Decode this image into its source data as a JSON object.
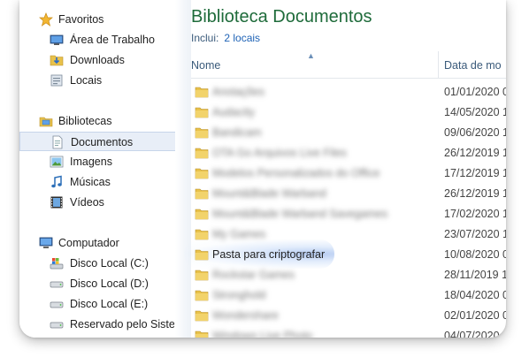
{
  "sidebar": {
    "favorites": {
      "label": "Favoritos",
      "items": [
        {
          "label": "Área de Trabalho",
          "icon": "desktop-icon"
        },
        {
          "label": "Downloads",
          "icon": "downloads-folder-icon"
        },
        {
          "label": "Locais",
          "icon": "recent-places-icon"
        }
      ]
    },
    "libraries": {
      "label": "Bibliotecas",
      "items": [
        {
          "label": "Documentos",
          "icon": "documents-icon",
          "selected": true
        },
        {
          "label": "Imagens",
          "icon": "pictures-icon"
        },
        {
          "label": "Músicas",
          "icon": "music-icon"
        },
        {
          "label": "Vídeos",
          "icon": "videos-icon"
        }
      ]
    },
    "computer": {
      "label": "Computador",
      "items": [
        {
          "label": "Disco Local (C:)",
          "icon": "system-drive-icon"
        },
        {
          "label": "Disco Local (D:)",
          "icon": "drive-icon"
        },
        {
          "label": "Disco Local (E:)",
          "icon": "drive-icon"
        },
        {
          "label": "Reservado pelo Sistema",
          "icon": "drive-icon"
        }
      ]
    }
  },
  "main": {
    "title": "Biblioteca Documentos",
    "includes_label": "Inclui:",
    "includes_link": "2 locais",
    "columns": {
      "name": "Nome",
      "date": "Data de mo"
    },
    "rows": [
      {
        "name": "Anotações",
        "date": "01/01/2020 0",
        "blurred": true
      },
      {
        "name": "Audacity",
        "date": "14/05/2020 1",
        "blurred": true
      },
      {
        "name": "Bandicam",
        "date": "09/06/2020 1",
        "blurred": true
      },
      {
        "name": "OTA Go Arquivos Live Files",
        "date": "26/12/2019 1",
        "blurred": true
      },
      {
        "name": "Modelos Personalizados do Office",
        "date": "17/12/2019 1",
        "blurred": true
      },
      {
        "name": "Mount&Blade Warband",
        "date": "26/12/2019 1",
        "blurred": true
      },
      {
        "name": "Mount&Blade Warband Savegames",
        "date": "17/02/2020 1",
        "blurred": true
      },
      {
        "name": "My Games",
        "date": "23/07/2020 1",
        "blurred": true
      },
      {
        "name": "Pasta para criptografar",
        "date": "10/08/2020 0",
        "blurred": false,
        "highlight": true
      },
      {
        "name": "Rockstar Games",
        "date": "28/11/2019 1",
        "blurred": true
      },
      {
        "name": "Stronghold",
        "date": "18/04/2020 0",
        "blurred": true
      },
      {
        "name": "Wondershare",
        "date": "02/01/2020 0",
        "blurred": true
      },
      {
        "name": "Windows Live Photo",
        "date": "04/07/2020",
        "blurred": true
      }
    ]
  },
  "colors": {
    "title": "#1e6b3a",
    "link": "#1f63b6",
    "folder": "#e8c14a",
    "selection": "#e8eef7"
  }
}
